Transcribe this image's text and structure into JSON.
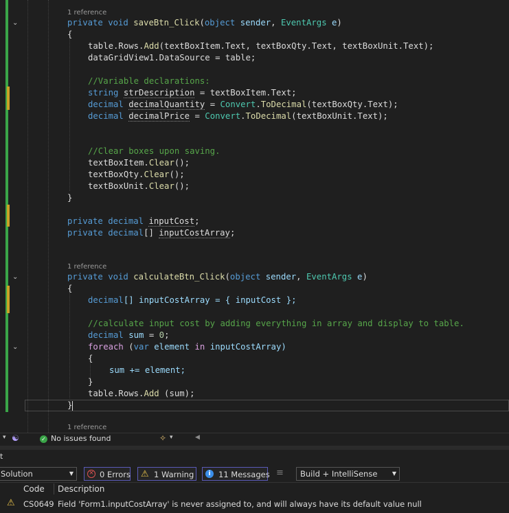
{
  "editor": {
    "references": [
      "1 reference",
      "1 reference",
      "1 reference"
    ],
    "lines": {
      "l1_kw": "private void",
      "l1_name": "saveBtn_Click",
      "l1_open": "(",
      "l1_type1": "object",
      "l1_p1": "sender",
      "l1_sep": ", ",
      "l1_type2": "EventArgs",
      "l1_p2": "e",
      "l1_close": ")",
      "brace_open": "{",
      "brace_close": "}",
      "l3_a": "table.Rows.",
      "l3_m": "Add",
      "l3_b": "(textBoxItem.Text, textBoxQty.Text, textBoxUnit.Text);",
      "l4": "dataGridView1.DataSource = table;",
      "c1": "//Variable declarations:",
      "l6_kw": "string",
      "l6_var": "strDescription",
      "l6_rest": " = textBoxItem.Text;",
      "l7_kw": "decimal",
      "l7_var": "decimalQuantity",
      "l7_eq": " = ",
      "l7_type": "Convert",
      "l7_dot": ".",
      "l7_m": "ToDecimal",
      "l7_rest": "(textBoxQty.Text);",
      "l8_kw": "decimal",
      "l8_var": "decimalPrice",
      "l8_eq": " = ",
      "l8_type": "Convert",
      "l8_dot": ".",
      "l8_m": "ToDecimal",
      "l8_rest": "(textBoxUnit.Text);",
      "c2": "//Clear boxes upon saving.",
      "l10_a": "textBoxItem.",
      "l11_a": "textBoxQty.",
      "l12_a": "textBoxUnit.",
      "clear_m": "Clear",
      "clear_rest": "();",
      "f1_kw": "private decimal",
      "f1_var": "inputCost",
      "f1_end": ";",
      "f2_kw": "private decimal",
      "f2_br": "[]",
      "f2_var": "inputCostArray",
      "f2_end": ";",
      "m2_kw": "private void",
      "m2_name": "calculateBtn_Click",
      "m2_kw2": "decimal",
      "m2_arr": "[] inputCostArray = { inputCost };",
      "c3": "//calculate input cost by adding everything in array and display to table.",
      "sum_kw": "decimal",
      "sum_var": "sum",
      "sum_eq": " = ",
      "sum_num": "0",
      "sum_end": ";",
      "foreach_kw": "foreach",
      "foreach_open": " (",
      "var_kw": "var",
      "foreach_el": " element ",
      "in_kw": "in",
      "foreach_rest": " inputCostArray)",
      "inner": "sum += element;",
      "final_a": "table.Rows.",
      "final_m": "Add",
      "final_b": " (sum);"
    }
  },
  "status": {
    "no_issues": "No issues found"
  },
  "error_list": {
    "scope": "Solution",
    "errors": "0 Errors",
    "warnings": "1 Warning",
    "messages": "11 Messages",
    "build_filter": "Build + IntelliSense",
    "col_code": "Code",
    "col_description": "Description",
    "rows": [
      {
        "code": "CS0649",
        "description": "Field 'Form1.inputCostArray' is never assigned to, and will always have its default value null"
      }
    ]
  },
  "colors": {
    "keyword": "#569cd6",
    "type": "#4ec9b0",
    "method": "#dcdcaa",
    "comment": "#57a64a",
    "gutter_change": "#3aa548"
  }
}
